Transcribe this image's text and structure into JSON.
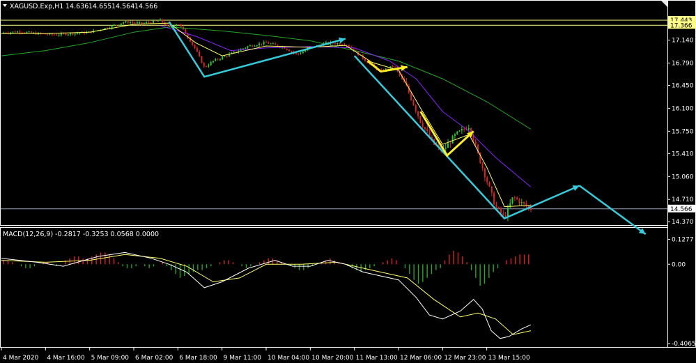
{
  "header": {
    "symbol": "XAGUSD.Exp,H1",
    "open": "14.636",
    "high": "14.655",
    "low": "14.564",
    "close": "14.566"
  },
  "macd_panel": {
    "title": "MACD(12,26,9) -0.2817 -0.3253 0.0568 0.0000"
  },
  "colors": {
    "background": "#000000",
    "bull_candle": "#22cc22",
    "bear_candle": "#dd2222",
    "ma_fast": "#ffff66",
    "ma_mid": "#8822ff",
    "ma_slow": "#22aa22",
    "arrow_cyan": "#33ccdd",
    "arrow_yellow": "#ffee22",
    "level_yellow": "#ffff88",
    "level_grey": "#9aa6c0",
    "macd_pos": "#dd2222",
    "macd_neg": "#22aa22",
    "macd_main": "#ffffff",
    "macd_signal": "#ffff66"
  },
  "price_tags": [
    {
      "value": "17.443",
      "bg": "#ffff88"
    },
    {
      "value": "17.366",
      "bg": "#ffff88"
    },
    {
      "value": "14.566",
      "bg": "#ffffff"
    }
  ],
  "chart_data": [
    {
      "type": "line",
      "ylim": [
        14.33,
        17.56
      ],
      "yticks": [
        "17.140",
        "16.790",
        "16.450",
        "16.100",
        "15.750",
        "15.410",
        "15.060",
        "14.710",
        "14.370"
      ],
      "ytick_values": [
        17.14,
        16.79,
        16.45,
        16.1,
        15.75,
        15.41,
        15.06,
        14.71,
        14.37
      ],
      "xlim": [
        0,
        120
      ],
      "xticks": [
        "4 Mar 2020",
        "4 Mar 16:00",
        "5 Mar 09:00",
        "6 Mar 02:00",
        "6 Mar 18:00",
        "9 Mar 11:00",
        "10 Mar 04:00",
        "10 Mar 20:00",
        "11 Mar 13:00",
        "12 Mar 06:00",
        "12 Mar 23:00",
        "13 Mar 15:00"
      ],
      "xtick_values": [
        0,
        10,
        20,
        30,
        40,
        50,
        60,
        70,
        80,
        90,
        100,
        110
      ],
      "levels": [
        17.443,
        17.366,
        14.566
      ],
      "price_path": [
        [
          0,
          17.25
        ],
        [
          4,
          17.27
        ],
        [
          8,
          17.24
        ],
        [
          12,
          17.22
        ],
        [
          16,
          17.24
        ],
        [
          20,
          17.26
        ],
        [
          24,
          17.33
        ],
        [
          28,
          17.42
        ],
        [
          32,
          17.39
        ],
        [
          36,
          17.44
        ],
        [
          38,
          17.33
        ],
        [
          40,
          17.4
        ],
        [
          42,
          17.22
        ],
        [
          44,
          17.0
        ],
        [
          46,
          16.72
        ],
        [
          48,
          16.82
        ],
        [
          52,
          16.93
        ],
        [
          56,
          17.05
        ],
        [
          60,
          17.1
        ],
        [
          64,
          17.03
        ],
        [
          67,
          16.92
        ],
        [
          70,
          17.02
        ],
        [
          74,
          17.1
        ],
        [
          78,
          17.08
        ],
        [
          80,
          16.98
        ],
        [
          83,
          16.8
        ],
        [
          86,
          16.66
        ],
        [
          89,
          16.75
        ],
        [
          92,
          16.4
        ],
        [
          95,
          15.9
        ],
        [
          98,
          15.55
        ],
        [
          100,
          15.45
        ],
        [
          103,
          15.7
        ],
        [
          106,
          15.83
        ],
        [
          108,
          15.4
        ],
        [
          110,
          15.0
        ],
        [
          112,
          14.6
        ],
        [
          114,
          14.43
        ],
        [
          116,
          14.75
        ],
        [
          118,
          14.65
        ],
        [
          120,
          14.566
        ]
      ],
      "ma_fast": [
        [
          0,
          17.24
        ],
        [
          10,
          17.24
        ],
        [
          20,
          17.26
        ],
        [
          30,
          17.38
        ],
        [
          38,
          17.4
        ],
        [
          44,
          17.1
        ],
        [
          50,
          16.9
        ],
        [
          60,
          17.05
        ],
        [
          70,
          17.03
        ],
        [
          78,
          17.06
        ],
        [
          84,
          16.8
        ],
        [
          90,
          16.68
        ],
        [
          95,
          16.1
        ],
        [
          100,
          15.55
        ],
        [
          106,
          15.7
        ],
        [
          110,
          15.2
        ],
        [
          114,
          14.6
        ],
        [
          120,
          14.62
        ]
      ],
      "ma_mid": [
        [
          36,
          17.36
        ],
        [
          44,
          17.2
        ],
        [
          52,
          16.98
        ],
        [
          60,
          17.02
        ],
        [
          70,
          17.04
        ],
        [
          80,
          17.02
        ],
        [
          88,
          16.82
        ],
        [
          94,
          16.55
        ],
        [
          100,
          16.05
        ],
        [
          106,
          15.75
        ],
        [
          112,
          15.35
        ],
        [
          120,
          14.9
        ]
      ],
      "ma_slow": [
        [
          0,
          16.9
        ],
        [
          10,
          16.98
        ],
        [
          20,
          17.1
        ],
        [
          30,
          17.26
        ],
        [
          38,
          17.34
        ],
        [
          50,
          17.28
        ],
        [
          60,
          17.21
        ],
        [
          70,
          17.13
        ],
        [
          80,
          16.98
        ],
        [
          90,
          16.82
        ],
        [
          100,
          16.55
        ],
        [
          110,
          16.2
        ],
        [
          120,
          15.78
        ]
      ],
      "arrows_cyan": [
        [
          [
            38,
            17.42
          ],
          [
            46,
            16.58
          ],
          [
            78,
            17.16
          ]
        ],
        [
          [
            80,
            16.9
          ],
          [
            114,
            14.42
          ],
          [
            131,
            14.92
          ]
        ],
        [
          [
            131,
            14.92
          ],
          [
            146,
            14.18
          ]
        ]
      ],
      "arrows_yellow": [
        [
          [
            83,
            16.82
          ],
          [
            86,
            16.66
          ],
          [
            92,
            16.73
          ]
        ],
        [
          [
            95,
            16.05
          ],
          [
            101,
            15.38
          ],
          [
            107,
            15.75
          ]
        ]
      ]
    },
    {
      "type": "bar",
      "title": "MACD(12,26,9) -0.2817 -0.3253 0.0568 0.0000",
      "ylim": [
        -0.42,
        0.14
      ],
      "yticks": [
        "0.1277",
        "0.00",
        "-0.4065"
      ],
      "ytick_values": [
        0.1277,
        0.0,
        -0.4065
      ],
      "xlim": [
        0,
        120
      ],
      "histogram": [
        0.02,
        0.02,
        0.01,
        0.0,
        -0.01,
        -0.02,
        -0.02,
        -0.01,
        0.0,
        0.01,
        0.01,
        0.0,
        -0.01,
        0.0,
        0.02,
        0.03,
        0.04,
        0.04,
        0.03,
        0.03,
        0.04,
        0.05,
        0.06,
        0.06,
        0.05,
        0.03,
        0.01,
        -0.01,
        -0.02,
        -0.02,
        -0.01,
        0.0,
        -0.01,
        -0.02,
        -0.01,
        0.0,
        0.01,
        -0.01,
        -0.03,
        -0.05,
        -0.07,
        -0.06,
        -0.05,
        -0.04,
        -0.03,
        -0.03,
        -0.02,
        -0.01,
        0.0,
        0.01,
        0.02,
        0.02,
        0.01,
        0.0,
        -0.01,
        -0.02,
        -0.01,
        0.0,
        0.01,
        0.02,
        0.03,
        0.03,
        0.02,
        0.01,
        0.0,
        -0.01,
        -0.02,
        -0.03,
        -0.03,
        -0.02,
        -0.01,
        0.0,
        0.01,
        0.02,
        0.03,
        0.02,
        0.01,
        0.0,
        -0.01,
        -0.02,
        -0.03,
        -0.04,
        -0.03,
        -0.02,
        -0.01,
        0.0,
        0.01,
        0.02,
        0.03,
        0.02,
        0.0,
        -0.02,
        -0.05,
        -0.08,
        -0.1,
        -0.09,
        -0.07,
        -0.05,
        -0.03,
        -0.02,
        0.02,
        0.05,
        0.07,
        0.06,
        0.04,
        0.01,
        -0.03,
        -0.07,
        -0.11,
        -0.1,
        -0.07,
        -0.04,
        -0.02,
        0.0,
        0.02,
        0.03,
        0.04,
        0.05,
        0.05,
        0.05
      ],
      "main_line": [
        [
          0,
          0.03
        ],
        [
          8,
          0.01
        ],
        [
          14,
          -0.01
        ],
        [
          22,
          0.04
        ],
        [
          28,
          0.06
        ],
        [
          34,
          0.03
        ],
        [
          38,
          0.0
        ],
        [
          42,
          -0.04
        ],
        [
          46,
          -0.12
        ],
        [
          50,
          -0.09
        ],
        [
          56,
          -0.02
        ],
        [
          62,
          0.02
        ],
        [
          66,
          -0.01
        ],
        [
          70,
          -0.01
        ],
        [
          74,
          0.02
        ],
        [
          78,
          0.0
        ],
        [
          82,
          -0.04
        ],
        [
          86,
          -0.06
        ],
        [
          90,
          -0.08
        ],
        [
          94,
          -0.17
        ],
        [
          97,
          -0.26
        ],
        [
          100,
          -0.28
        ],
        [
          104,
          -0.24
        ],
        [
          107,
          -0.18
        ],
        [
          109,
          -0.23
        ],
        [
          111,
          -0.34
        ],
        [
          113,
          -0.38
        ],
        [
          115,
          -0.37
        ],
        [
          118,
          -0.33
        ],
        [
          120,
          -0.31
        ]
      ],
      "signal_line": [
        [
          0,
          0.02
        ],
        [
          10,
          0.01
        ],
        [
          20,
          0.02
        ],
        [
          28,
          0.05
        ],
        [
          36,
          0.03
        ],
        [
          42,
          -0.01
        ],
        [
          48,
          -0.09
        ],
        [
          54,
          -0.07
        ],
        [
          60,
          0.0
        ],
        [
          68,
          0.0
        ],
        [
          76,
          0.01
        ],
        [
          84,
          -0.03
        ],
        [
          92,
          -0.07
        ],
        [
          98,
          -0.18
        ],
        [
          104,
          -0.27
        ],
        [
          108,
          -0.25
        ],
        [
          112,
          -0.28
        ],
        [
          116,
          -0.36
        ],
        [
          120,
          -0.34
        ]
      ]
    }
  ]
}
